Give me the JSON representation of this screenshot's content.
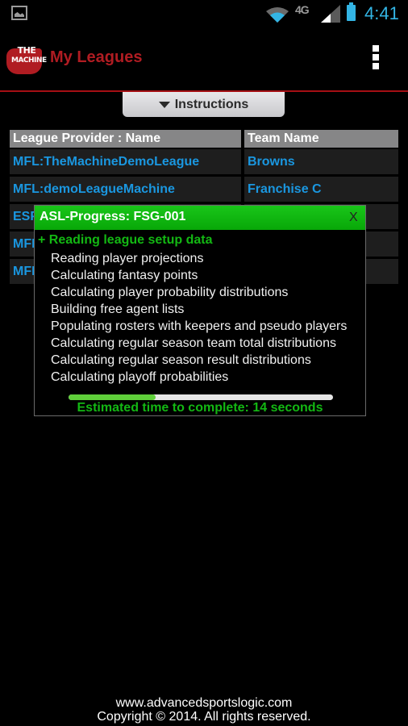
{
  "status_bar": {
    "notification_icon": "image-icon",
    "wifi_icon": "wifi-icon",
    "network": "4G",
    "signal_icon": "signal-icon",
    "battery_icon": "battery-icon",
    "time": "4:41"
  },
  "action_bar": {
    "logo_line1": "THE",
    "logo_line2": "MACHINE",
    "title": "My Leagues",
    "overflow_icon": "overflow-menu-icon",
    "accent_color": "#b01c22"
  },
  "instructions": {
    "label": "Instructions",
    "icon": "triangle-down-icon"
  },
  "table": {
    "headers": [
      "League Provider : Name",
      "Team Name"
    ],
    "rows": [
      {
        "league": "MFL:TheMachineDemoLeague",
        "team": "Browns"
      },
      {
        "league": "MFL:demoLeagueMachine",
        "team": "Franchise C"
      },
      {
        "league": "ESPN",
        "team": ""
      },
      {
        "league": "MFL",
        "team": ""
      },
      {
        "league": "MFL",
        "team": ""
      }
    ],
    "link_color": "#1a97e0"
  },
  "dialog": {
    "title": "ASL-Progress: FSG-001",
    "close_label": "X",
    "active_step": "+ Reading league setup data",
    "steps": [
      "Reading player projections",
      "Calculating fantasy points",
      "Calculating player probability distributions",
      "Building free agent lists",
      "Populating rosters with keepers and pseudo players",
      "Calculating regular season team total distributions",
      "Calculating regular season result distributions",
      "Calculating playoff probabilities"
    ],
    "progress_percent": 33,
    "eta": "Estimated time to complete: 14 seconds",
    "accent_color": "#13b813"
  },
  "footer": {
    "url": "www.advancedsportslogic.com",
    "copyright": "Copyright © 2014. All rights reserved."
  }
}
